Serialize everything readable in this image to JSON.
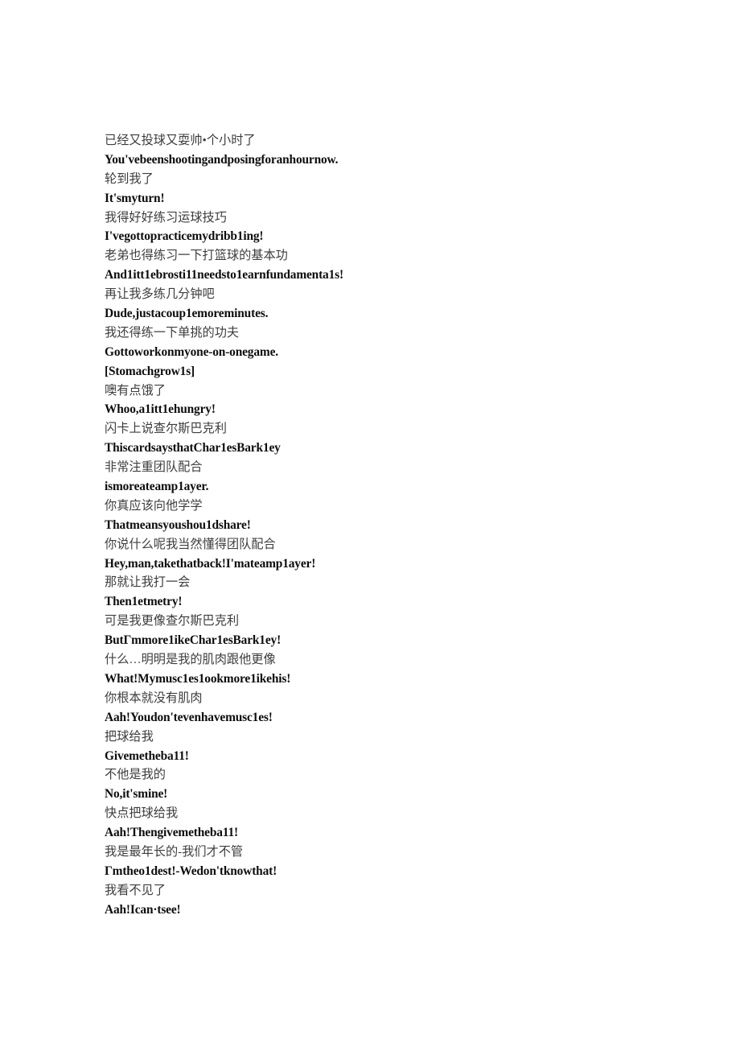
{
  "document": {
    "type": "bilingual-subtitle-transcript",
    "background_color": "#ffffff",
    "zh_text_color": "#3d3d3d",
    "en_text_color": "#0d0d0d",
    "lines": [
      {
        "lang": "zh",
        "text": "已经又投球又耍帅•个小时了"
      },
      {
        "lang": "en",
        "text": "You'vebeenshootingandposingforanhournow."
      },
      {
        "lang": "zh",
        "text": "轮到我了"
      },
      {
        "lang": "en",
        "text": "It'smyturn!"
      },
      {
        "lang": "zh",
        "text": "我得好好练习运球技巧"
      },
      {
        "lang": "en",
        "text": "I'vegottopracticemydribb1ing!"
      },
      {
        "lang": "zh",
        "text": "老弟也得练习一下打篮球的基本功"
      },
      {
        "lang": "en",
        "text": "And1itt1ebrosti11needsto1earnfundamenta1s!"
      },
      {
        "lang": "zh",
        "text": "再让我多练几分钟吧"
      },
      {
        "lang": "en",
        "text": "Dude,justacoup1emoreminutes."
      },
      {
        "lang": "zh",
        "text": "我还得练一下单挑的功夫"
      },
      {
        "lang": "en",
        "text": "Gottoworkonmyone-on-onegame."
      },
      {
        "lang": "en",
        "text": "[Stomachgrow1s]"
      },
      {
        "lang": "zh",
        "text": "噢有点饿了"
      },
      {
        "lang": "en",
        "text": "Whoo,a1itt1ehungry!"
      },
      {
        "lang": "zh",
        "text": "闪卡上说查尔斯巴克利"
      },
      {
        "lang": "en",
        "text": "ThiscardsaysthatChar1esBark1ey"
      },
      {
        "lang": "zh",
        "text": "非常注重团队配合"
      },
      {
        "lang": "en",
        "text": "ismoreateamp1ayer."
      },
      {
        "lang": "zh",
        "text": "你真应该向他学学"
      },
      {
        "lang": "en",
        "text": "Thatmeansyoushou1dshare!"
      },
      {
        "lang": "zh",
        "text": "你说什么呢我当然懂得团队配合"
      },
      {
        "lang": "en",
        "text": "Hey,man,takethatback!I'mateamp1ayer!"
      },
      {
        "lang": "zh",
        "text": "那就让我打一会"
      },
      {
        "lang": "en",
        "text": "Then1etmetry!"
      },
      {
        "lang": "zh",
        "text": "可是我更像查尔斯巴克利"
      },
      {
        "lang": "en",
        "text": "ButΓmmore1ikeChar1esBark1ey!"
      },
      {
        "lang": "zh",
        "text": "什么…明明是我的肌肉跟他更像"
      },
      {
        "lang": "en",
        "text": "What!Mymusc1es1ookmore1ikehis!"
      },
      {
        "lang": "zh",
        "text": "你根本就没有肌肉"
      },
      {
        "lang": "en",
        "text": "Aah!Youdon'tevenhavemusc1es!"
      },
      {
        "lang": "zh",
        "text": "把球给我"
      },
      {
        "lang": "en",
        "text": "Givemetheba11!"
      },
      {
        "lang": "zh",
        "text": "不他是我的"
      },
      {
        "lang": "en",
        "text": "No,it'smine!"
      },
      {
        "lang": "zh",
        "text": "快点把球给我"
      },
      {
        "lang": "en",
        "text": "Aah!Thengivemetheba11!"
      },
      {
        "lang": "zh",
        "text": "我是最年长的-我们才不管"
      },
      {
        "lang": "en",
        "text": "Γmtheo1dest!-Wedon'tknowthat!"
      },
      {
        "lang": "zh",
        "text": "我看不见了"
      },
      {
        "lang": "en",
        "text": "Aah!Ican·tsee!"
      }
    ]
  }
}
